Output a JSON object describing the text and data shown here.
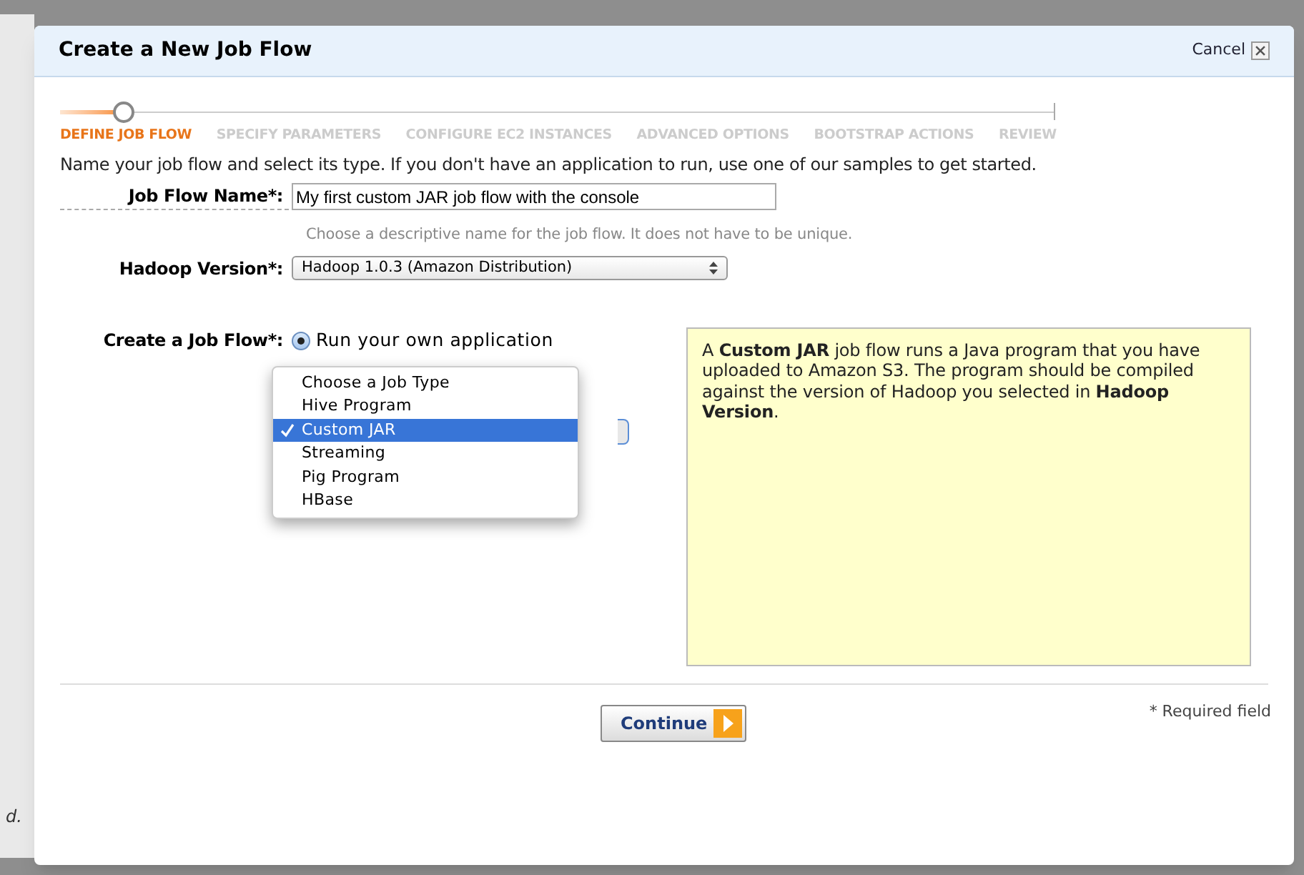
{
  "background_text": "d.",
  "dialog": {
    "title": "Create a New Job Flow",
    "cancel": "Cancel"
  },
  "steps": [
    {
      "label": "DEFINE JOB FLOW",
      "selected": true
    },
    {
      "label": "SPECIFY PARAMETERS",
      "selected": false
    },
    {
      "label": "CONFIGURE EC2 INSTANCES",
      "selected": false
    },
    {
      "label": "ADVANCED OPTIONS",
      "selected": false
    },
    {
      "label": "BOOTSTRAP ACTIONS",
      "selected": false
    },
    {
      "label": "REVIEW",
      "selected": false
    }
  ],
  "intro": "Name your job flow and select its type. If you don't have an application to run, use one of our samples to get started.",
  "job_flow_name": {
    "label": "Job Flow Name*:",
    "value": "My first custom JAR job flow with the console",
    "hint": "Choose a descriptive name for the job flow. It does not have to be unique."
  },
  "hadoop_version": {
    "label": "Hadoop Version*:",
    "value": "Hadoop 1.0.3 (Amazon Distribution)"
  },
  "create_job_flow": {
    "label": "Create a Job Flow*:",
    "option": {
      "label": "Run your own application",
      "selected": true
    }
  },
  "job_type_menu": [
    {
      "label": "Choose a Job Type",
      "selected": false
    },
    {
      "label": "Hive Program",
      "selected": false
    },
    {
      "label": "Custom JAR",
      "selected": true
    },
    {
      "label": "Streaming",
      "selected": false
    },
    {
      "label": "Pig Program",
      "selected": false
    },
    {
      "label": "HBase",
      "selected": false
    }
  ],
  "info": "A **Custom JAR** job flow runs a Java program that you have uploaded to Amazon S3. The program should be compiled against the version of Hadoop you selected in **Hadoop Version**.",
  "continue": "Continue",
  "required_note": "* Required field"
}
